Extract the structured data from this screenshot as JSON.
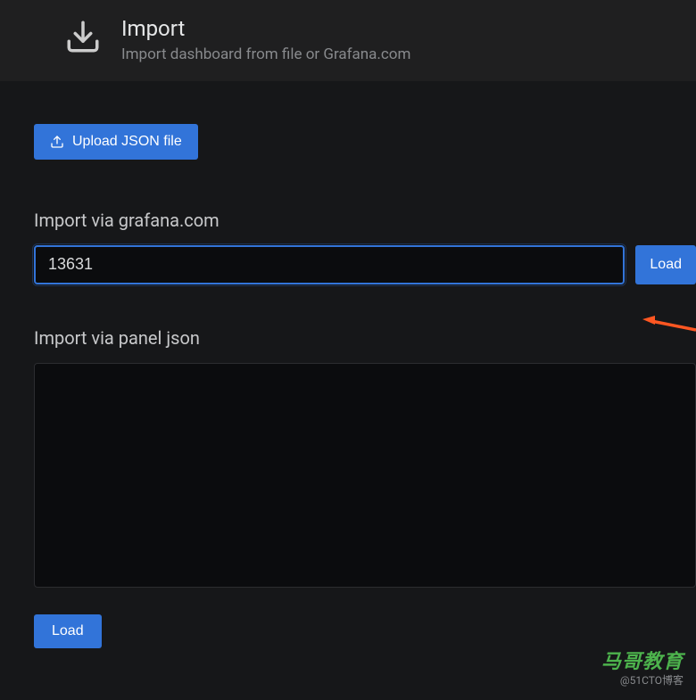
{
  "header": {
    "title": "Import",
    "subtitle": "Import dashboard from file or Grafana.com"
  },
  "upload": {
    "button_label": "Upload JSON file"
  },
  "grafana_section": {
    "label": "Import via grafana.com",
    "input_value": "13631",
    "load_label": "Load"
  },
  "panel_json_section": {
    "label": "Import via panel json",
    "textarea_value": ""
  },
  "bottom": {
    "load_label": "Load"
  },
  "watermark": {
    "main": "马哥教育",
    "sub": "@51CTO博客"
  }
}
